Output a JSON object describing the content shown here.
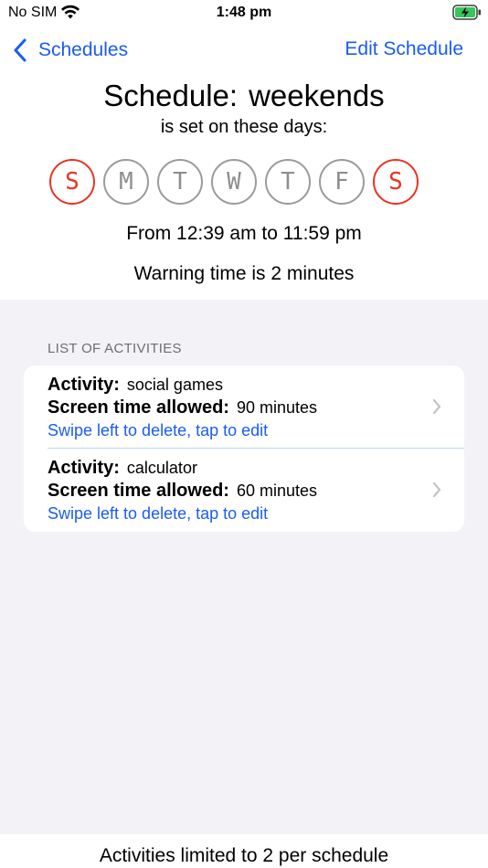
{
  "status_bar": {
    "carrier": "No SIM",
    "time": "1:48 pm"
  },
  "nav": {
    "back_label": "Schedules",
    "edit_label": "Edit Schedule"
  },
  "schedule": {
    "title_prefix": "Schedule:",
    "name": "weekends",
    "subtitle": "is set on these days:",
    "days": [
      {
        "letter": "S",
        "active": true
      },
      {
        "letter": "M",
        "active": false
      },
      {
        "letter": "T",
        "active": false
      },
      {
        "letter": "W",
        "active": false
      },
      {
        "letter": "T",
        "active": false
      },
      {
        "letter": "F",
        "active": false
      },
      {
        "letter": "S",
        "active": true
      }
    ],
    "time_range": "From 12:39 am to 11:59 pm",
    "warning": "Warning time is 2 minutes"
  },
  "activities": {
    "header": "LIST OF ACTIVITIES",
    "items": [
      {
        "activity_label": "Activity:",
        "activity_name": "social games",
        "time_label": "Screen time allowed:",
        "time_value": "90 minutes",
        "hint": "Swipe left to delete, tap to edit"
      },
      {
        "activity_label": "Activity:",
        "activity_name": "calculator",
        "time_label": "Screen time allowed:",
        "time_value": "60 minutes",
        "hint": "Swipe left to delete, tap to edit"
      }
    ]
  },
  "footer": {
    "text": "Activities limited to 2 per schedule"
  },
  "colors": {
    "accent": "#1a5cf2",
    "active_day": "#ea3323",
    "inactive_day": "#9b9b9b",
    "background": "#f2f2f7"
  }
}
